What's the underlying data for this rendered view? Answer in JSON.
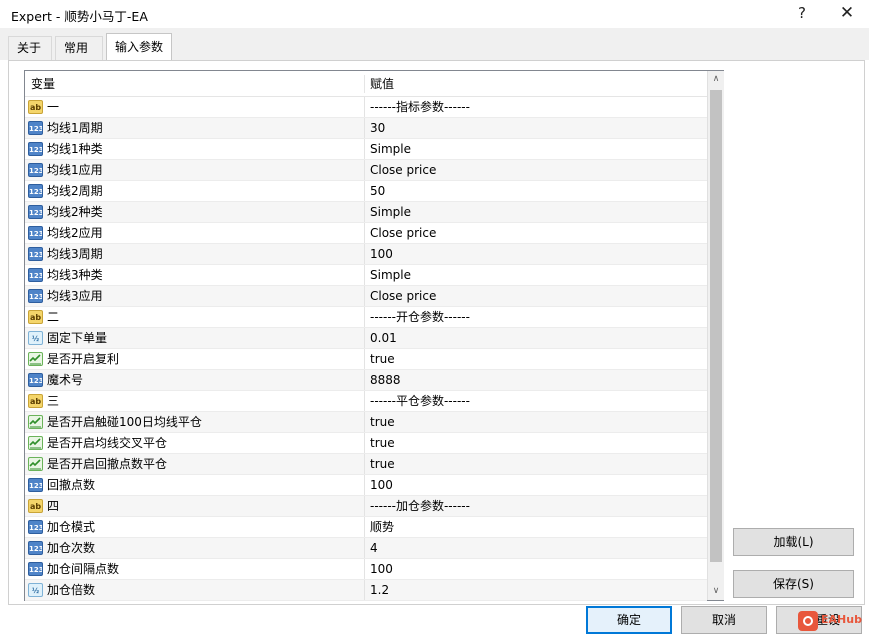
{
  "window": {
    "title": "Expert - 顺势小马丁-EA",
    "help_glyph": "?",
    "close_glyph": "✕"
  },
  "tabs": [
    {
      "label": "关于",
      "active": false
    },
    {
      "label": "常用",
      "active": false
    },
    {
      "label": "输入参数",
      "active": true
    }
  ],
  "grid": {
    "col_variable": "变量",
    "col_value": "赋值",
    "rows": [
      {
        "icon": "ab",
        "icon_text": "ab",
        "name": "一",
        "value": "------指标参数------"
      },
      {
        "icon": "int",
        "icon_text": "123",
        "name": "均线1周期",
        "value": "30"
      },
      {
        "icon": "int",
        "icon_text": "123",
        "name": "均线1种类",
        "value": "Simple"
      },
      {
        "icon": "int",
        "icon_text": "123",
        "name": "均线1应用",
        "value": "Close price"
      },
      {
        "icon": "int",
        "icon_text": "123",
        "name": "均线2周期",
        "value": "50"
      },
      {
        "icon": "int",
        "icon_text": "123",
        "name": "均线2种类",
        "value": "Simple"
      },
      {
        "icon": "int",
        "icon_text": "123",
        "name": "均线2应用",
        "value": "Close price"
      },
      {
        "icon": "int",
        "icon_text": "123",
        "name": "均线3周期",
        "value": "100"
      },
      {
        "icon": "int",
        "icon_text": "123",
        "name": "均线3种类",
        "value": "Simple"
      },
      {
        "icon": "int",
        "icon_text": "123",
        "name": "均线3应用",
        "value": "Close price"
      },
      {
        "icon": "ab",
        "icon_text": "ab",
        "name": "二",
        "value": "------开仓参数------"
      },
      {
        "icon": "dbl",
        "icon_text": "½",
        "name": "固定下单量",
        "value": "0.01"
      },
      {
        "icon": "bool",
        "icon_text": "",
        "name": "是否开启复利",
        "value": "true"
      },
      {
        "icon": "int",
        "icon_text": "123",
        "name": "魔术号",
        "value": "8888"
      },
      {
        "icon": "ab",
        "icon_text": "ab",
        "name": "三",
        "value": "------平仓参数------"
      },
      {
        "icon": "bool",
        "icon_text": "",
        "name": "是否开启触碰100日均线平仓",
        "value": "true"
      },
      {
        "icon": "bool",
        "icon_text": "",
        "name": "是否开启均线交叉平仓",
        "value": "true"
      },
      {
        "icon": "bool",
        "icon_text": "",
        "name": "是否开启回撤点数平仓",
        "value": "true"
      },
      {
        "icon": "int",
        "icon_text": "123",
        "name": "回撤点数",
        "value": "100"
      },
      {
        "icon": "ab",
        "icon_text": "ab",
        "name": "四",
        "value": "------加仓参数------"
      },
      {
        "icon": "int",
        "icon_text": "123",
        "name": "加仓模式",
        "value": "顺势"
      },
      {
        "icon": "int",
        "icon_text": "123",
        "name": "加仓次数",
        "value": "4"
      },
      {
        "icon": "int",
        "icon_text": "123",
        "name": "加仓间隔点数",
        "value": "100"
      },
      {
        "icon": "dbl",
        "icon_text": "½",
        "name": "加仓倍数",
        "value": "1.2"
      }
    ],
    "scroll_up_glyph": "∧",
    "scroll_down_glyph": "∨"
  },
  "buttons": {
    "load": "加载(L)",
    "save": "保存(S)",
    "ok": "确定",
    "cancel": "取消",
    "reset": "重设"
  },
  "watermark": {
    "text": "EAHub"
  }
}
